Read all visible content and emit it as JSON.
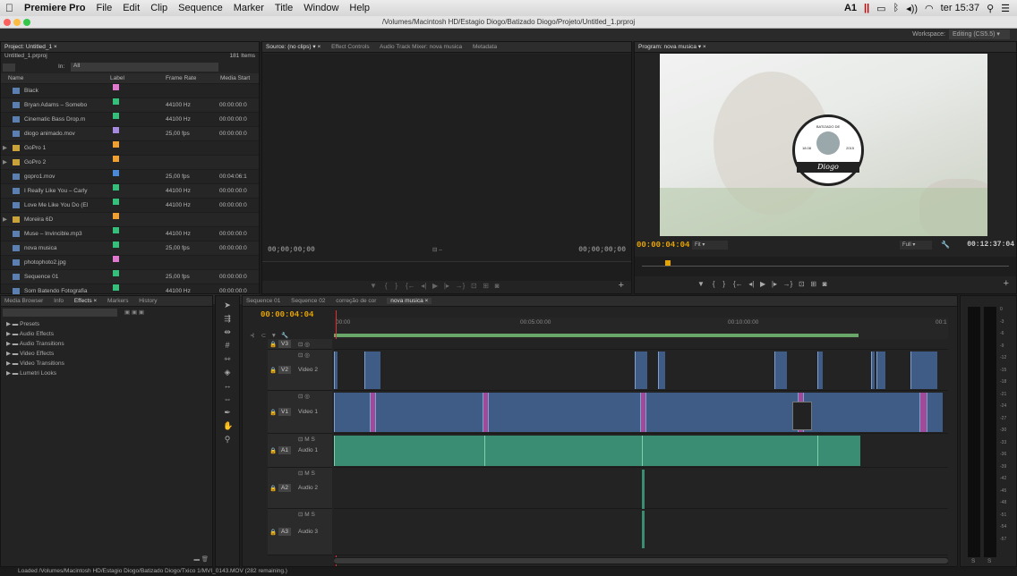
{
  "menubar": {
    "apple": "",
    "app": "Premiere Pro",
    "items": [
      "File",
      "Edit",
      "Clip",
      "Sequence",
      "Marker",
      "Title",
      "Window",
      "Help"
    ],
    "status": "A1",
    "clock": "ter 15:37"
  },
  "titlebar": {
    "path": "/Volumes/Macintosh HD/Estagio Diogo/Batizado Diogo/Projeto/Untitled_1.prproj"
  },
  "workspace": {
    "label": "Workspace:",
    "value": "Editing (CS5.5)"
  },
  "project": {
    "tab": "Project: Untitled_1 ×",
    "file": "Untitled_1.prproj",
    "count": "181 Items",
    "in_label": "In:",
    "in_value": "All",
    "columns": [
      "Name",
      "Label",
      "Frame Rate",
      "Media Start"
    ],
    "items": [
      {
        "name": "Black",
        "color": "#e078d0",
        "rate": "",
        "start": ""
      },
      {
        "name": "Bryan Adams – Somebo",
        "color": "#34c07a",
        "rate": "44100 Hz",
        "start": "00:00:00:0"
      },
      {
        "name": "Cinematic Bass Drop.m",
        "color": "#34c07a",
        "rate": "44100 Hz",
        "start": "00:00:00:0"
      },
      {
        "name": "diogo animado.mov",
        "color": "#a68ae0",
        "rate": "25,00 fps",
        "start": "00:00:00:0"
      },
      {
        "name": "GoPro 1",
        "color": "#f0a030",
        "rate": "",
        "start": "",
        "folder": true
      },
      {
        "name": "GoPro 2",
        "color": "#f0a030",
        "rate": "",
        "start": "",
        "folder": true
      },
      {
        "name": "gopro1.mov",
        "color": "#4a88d8",
        "rate": "25,00 fps",
        "start": "00:04:06:1"
      },
      {
        "name": "I Really Like You – Carly",
        "color": "#34c07a",
        "rate": "44100 Hz",
        "start": "00:00:00:0"
      },
      {
        "name": "Love Me Like You Do (El",
        "color": "#34c07a",
        "rate": "44100 Hz",
        "start": "00:00:00:0"
      },
      {
        "name": "Moreira 6D",
        "color": "#f0a030",
        "rate": "",
        "start": "",
        "folder": true
      },
      {
        "name": "Muse – Invincible.mp3",
        "color": "#34c07a",
        "rate": "44100 Hz",
        "start": "00:00:00:0"
      },
      {
        "name": "nova musica",
        "color": "#34c07a",
        "rate": "25,00 fps",
        "start": "00:00:00:0"
      },
      {
        "name": "photophoto2.jpg",
        "color": "#e078d0",
        "rate": "",
        "start": ""
      },
      {
        "name": "Sequence 01",
        "color": "#34c07a",
        "rate": "25,00 fps",
        "start": "00:00:00:0"
      },
      {
        "name": "Som Batendo Fotografia",
        "color": "#34c07a",
        "rate": "44100 Hz",
        "start": "00:00:00:0"
      }
    ]
  },
  "source": {
    "tabs": [
      "Source: (no clips) ▾ ×",
      "Effect Controls",
      "Audio Track Mixer: nova musica",
      "Metadata"
    ],
    "tc_left": "00;00;00;00",
    "tc_right": "00;00;00;00"
  },
  "program": {
    "tab": "Program: nova musica ▾ ×",
    "tc": "00:00:04:04",
    "fit": "Fit",
    "full": "Full",
    "duration": "00:12:37:04",
    "badge_top": "BATIZADO DE",
    "badge_name": "Diogo",
    "badge_l": "18.08",
    "badge_r": "2015"
  },
  "effects": {
    "tabs": [
      "Media Browser",
      "Info",
      "Effects ×",
      "Markers",
      "History"
    ],
    "items": [
      "Presets",
      "Audio Effects",
      "Audio Transitions",
      "Video Effects",
      "Video Transitions",
      "Lumetri Looks"
    ]
  },
  "timeline": {
    "tabs": [
      "Sequence 01",
      "Sequence 02",
      "correção de cor",
      "nova musica ×"
    ],
    "tc": "00:00:04:04",
    "ruler": [
      "00:00",
      "00:05:00:00",
      "00:10:00:00",
      "00:1"
    ],
    "tracks": [
      {
        "id": "V3",
        "name": ""
      },
      {
        "id": "V2",
        "name": "Video 2"
      },
      {
        "id": "V1",
        "name": "Video 1"
      },
      {
        "id": "A1",
        "name": "Audio 1"
      },
      {
        "id": "A2",
        "name": "Audio 2"
      },
      {
        "id": "A3",
        "name": "Audio 3"
      }
    ]
  },
  "meter": {
    "scale": [
      "0",
      "-3",
      "-6",
      "-9",
      "-12",
      "-15",
      "-18",
      "-21",
      "-24",
      "-27",
      "-30",
      "-33",
      "-36",
      "-39",
      "-42",
      "-45",
      "-48",
      "-51",
      "-54",
      "-57"
    ],
    "lr": [
      "S",
      "S"
    ]
  },
  "status": {
    "text": "Loaded /Volumes/Macintosh HD/Estagio Diogo/Batizado  Diogo/Txico 1/MVI_0143.MOV (282 remaining.)"
  }
}
